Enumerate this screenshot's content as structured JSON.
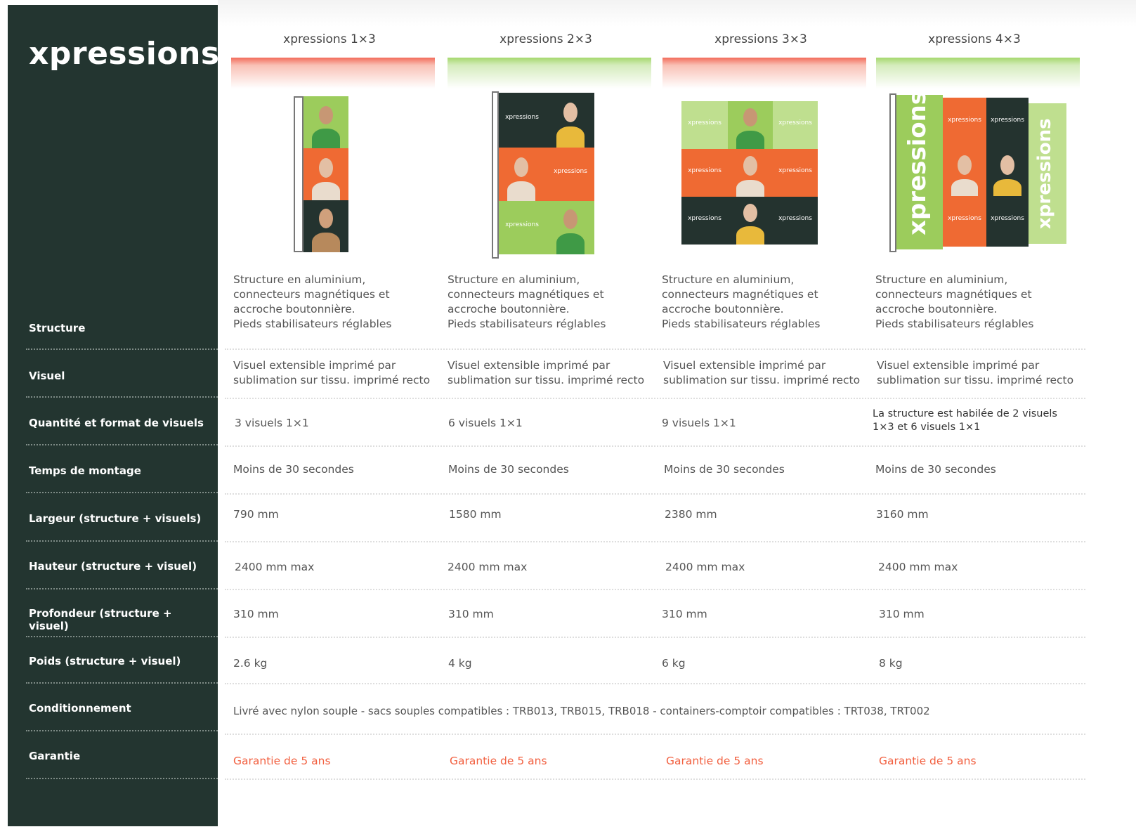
{
  "brand": "xpressions",
  "row_labels": [
    "Structure",
    "Visuel",
    "Quantité et format de visuels",
    "Temps de montage",
    "Largeur (structure + visuels)",
    "Hauteur  (structure + visuel)",
    "Profondeur  (structure + visuel)",
    "Poids  (structure + visuel)",
    "Conditionnement",
    "Garantie"
  ],
  "columns": [
    {
      "title": "xpressions 1×3",
      "accent": "#f26d5b",
      "structure": [
        "Structure en aluminium,",
        "connecteurs magnétiques et",
        "accroche boutonnière.",
        "Pieds stabilisateurs réglables"
      ],
      "visuel": [
        "Visuel extensible imprimé par",
        "sublimation sur tissu. imprimé recto"
      ],
      "quantite": "3 visuels 1×1",
      "temps": "Moins de 30 secondes",
      "largeur": "790 mm",
      "hauteur": "2400 mm max",
      "profondeur": "310 mm",
      "poids": "2.6 kg",
      "garantie": "Garantie de 5 ans"
    },
    {
      "title": "xpressions 2×3",
      "accent": "#a5d86e",
      "structure": [
        "Structure en aluminium,",
        "connecteurs magnétiques et",
        "accroche boutonnière.",
        "Pieds stabilisateurs réglables"
      ],
      "visuel": [
        "Visuel extensible imprimé par",
        "sublimation sur tissu. imprimé recto"
      ],
      "quantite": "6 visuels 1×1",
      "temps": "Moins de 30 secondes",
      "largeur": "1580 mm",
      "hauteur": "2400 mm max",
      "profondeur": "310 mm",
      "poids": "4 kg",
      "garantie": "Garantie de 5 ans"
    },
    {
      "title": "xpressions 3×3",
      "accent": "#f26d5b",
      "structure": [
        "Structure en aluminium,",
        "connecteurs magnétiques et",
        "accroche boutonnière.",
        "Pieds stabilisateurs réglables"
      ],
      "visuel": [
        "Visuel extensible imprimé par",
        "sublimation sur tissu. imprimé recto"
      ],
      "quantite": "9 visuels 1×1",
      "temps": "Moins de 30 secondes",
      "largeur": "2380 mm",
      "hauteur": "2400 mm max",
      "profondeur": "310 mm",
      "poids": "6 kg",
      "garantie": "Garantie de 5 ans"
    },
    {
      "title": "xpressions 4×3",
      "accent": "#a5d86e",
      "structure": [
        "Structure en aluminium,",
        "connecteurs magnétiques et",
        "accroche boutonnière.",
        "Pieds stabilisateurs réglables"
      ],
      "visuel": [
        "Visuel extensible imprimé par",
        "sublimation sur tissu. imprimé recto"
      ],
      "quantite": "La structure est habilée de 2 visuels 1×3 et 6 visuels 1×1",
      "temps": "Moins de 30 secondes",
      "largeur": "3160 mm",
      "hauteur": "2400 mm max",
      "profondeur": "310 mm",
      "poids": "8 kg",
      "garantie": "Garantie de 5 ans"
    }
  ],
  "conditionnement": "Livré avec nylon souple - sacs souples compatibles : TRB013, TRB015, TRB018 - containers-comptoir compatibles : TRT038, TRT002",
  "colors": {
    "sidebar": "#233530",
    "red_accent": "#f26d5b",
    "green_accent": "#a5d86e",
    "warranty": "#f26040",
    "panel_green": "#9ccc5c",
    "panel_orange": "#ef6a33",
    "panel_dark": "#24332f"
  },
  "icons": [
    "product-photo-1x3",
    "product-photo-2x3",
    "product-photo-3x3",
    "product-photo-4x3"
  ],
  "panel_text": "xpressions"
}
